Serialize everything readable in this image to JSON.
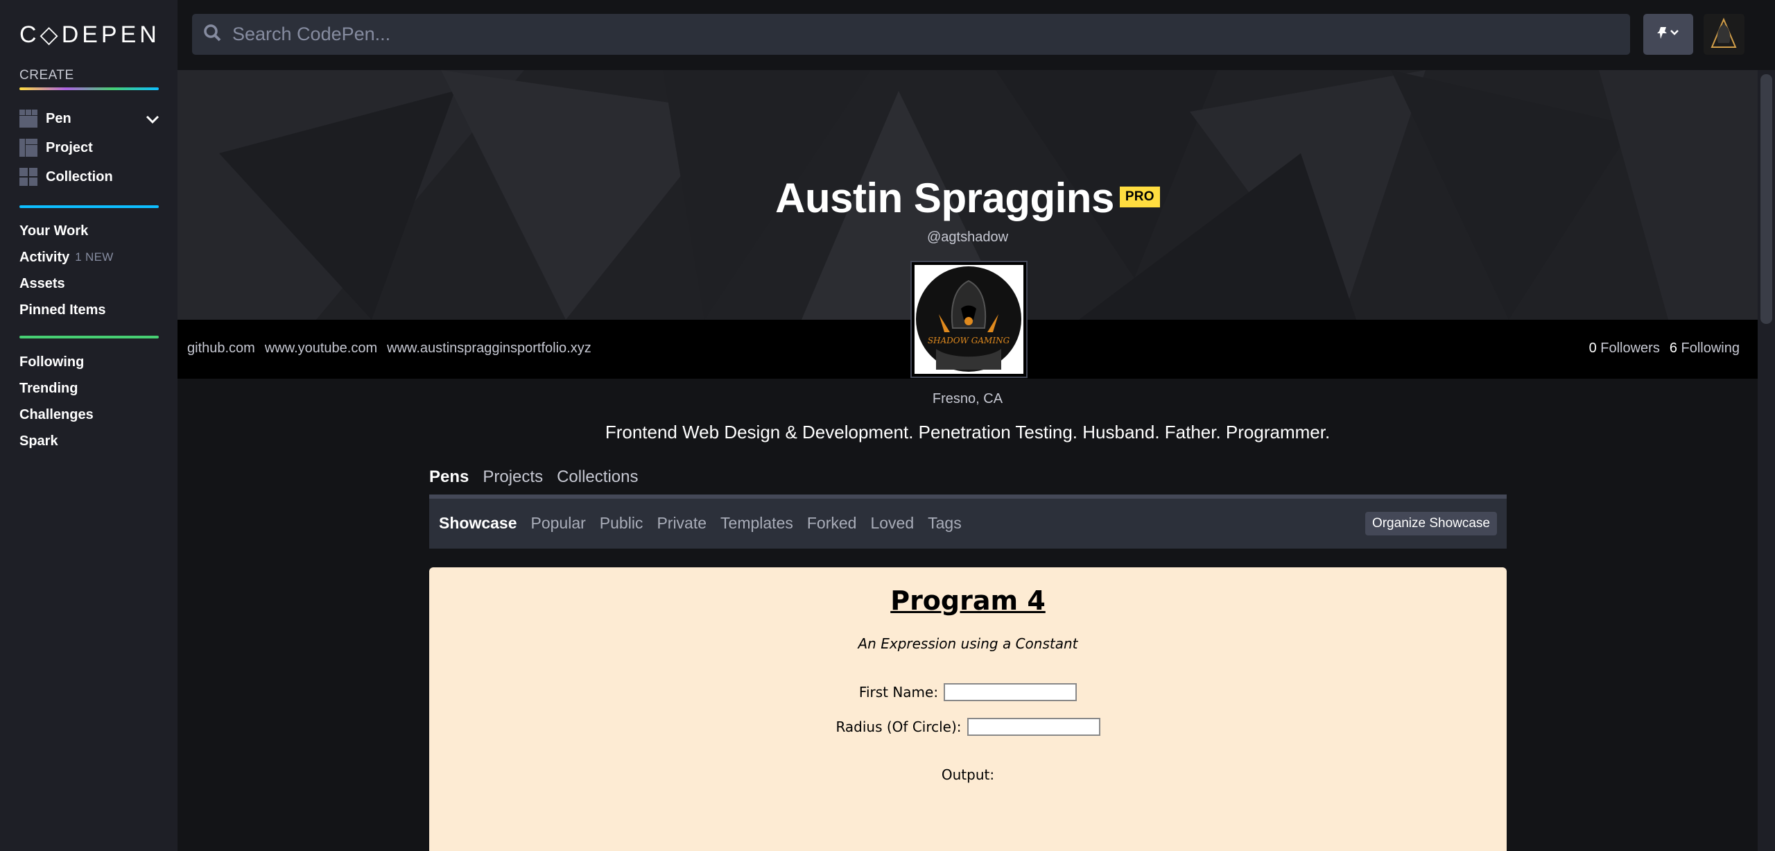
{
  "app": {
    "logo": "C◇DEPEN"
  },
  "sidebar": {
    "create_label": "CREATE",
    "create_items": [
      {
        "label": "Pen"
      },
      {
        "label": "Project"
      },
      {
        "label": "Collection"
      }
    ],
    "group1": [
      {
        "label": "Your Work"
      },
      {
        "label": "Activity",
        "badge": "1 NEW"
      },
      {
        "label": "Assets"
      },
      {
        "label": "Pinned Items"
      }
    ],
    "group2": [
      {
        "label": "Following"
      },
      {
        "label": "Trending"
      },
      {
        "label": "Challenges"
      },
      {
        "label": "Spark"
      }
    ]
  },
  "search": {
    "placeholder": "Search CodePen..."
  },
  "profile": {
    "name": "Austin Spraggins",
    "badge": "PRO",
    "handle": "@agtshadow",
    "links": [
      "github.com",
      "www.youtube.com",
      "www.austinspragginsportfolio.xyz"
    ],
    "followers_count": "0",
    "followers_label": "Followers",
    "following_count": "6",
    "following_label": "Following",
    "avatar_text": "SHADOW GAMING",
    "location": "Fresno, CA",
    "bio": "Frontend Web Design & Development. Penetration Testing. Husband. Father. Programmer."
  },
  "tabs": [
    "Pens",
    "Projects",
    "Collections"
  ],
  "subnav": {
    "items": [
      "Showcase",
      "Popular",
      "Public",
      "Private",
      "Templates",
      "Forked",
      "Loved",
      "Tags"
    ],
    "organize_button": "Organize Showcase"
  },
  "preview": {
    "title": "Program 4",
    "subtitle": "An Expression using a Constant",
    "field1_label": "First Name:",
    "field2_label": "Radius (Of Circle):",
    "output_label": "Output:"
  },
  "colors": {
    "accent_yellow": "#ffdd40",
    "accent_blue": "#0ebeff",
    "accent_green": "#47cf73",
    "preview_bg": "#fdebd3"
  }
}
